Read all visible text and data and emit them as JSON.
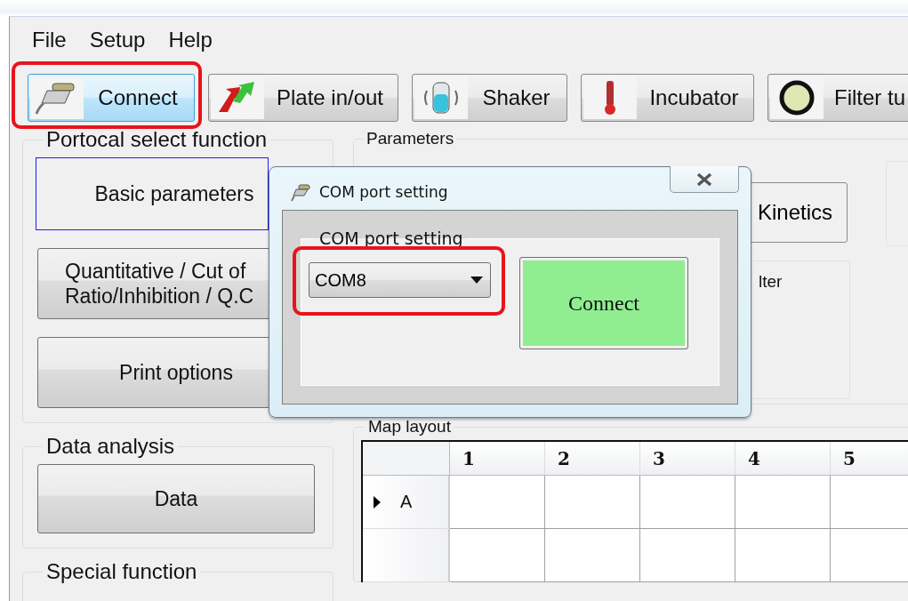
{
  "menu": [
    {
      "label": "File"
    },
    {
      "label": "Setup"
    },
    {
      "label": "Help"
    }
  ],
  "toolbar": [
    {
      "label": "Connect",
      "kind": "plug",
      "selected": true,
      "highlighted": true
    },
    {
      "label": "Plate in/out",
      "kind": "arrows",
      "selected": false,
      "highlighted": false
    },
    {
      "label": "Shaker",
      "kind": "tube",
      "selected": false,
      "highlighted": false
    },
    {
      "label": "Incubator",
      "kind": "thermometer",
      "selected": false,
      "highlighted": false
    },
    {
      "label": "Filter tu",
      "kind": "ring",
      "selected": false,
      "highlighted": false
    }
  ],
  "protocol_group": {
    "title": "Portocal select function",
    "buttons": [
      {
        "label": "Basic parameters",
        "selected": true
      },
      {
        "label": "Quantitative / Cut of\nRatio/Inhibition / Q.C",
        "selected": false
      },
      {
        "label": "Print options",
        "selected": false
      }
    ]
  },
  "data_group": {
    "title": "Data analysis",
    "buttons": [
      {
        "label": "Data",
        "selected": false
      }
    ]
  },
  "special_group": {
    "title": "Special function"
  },
  "parameters_group": {
    "title": "Parameters",
    "mode_button": "Kinetics",
    "filter_label": "lter"
  },
  "map_layout": {
    "title": "Map layout",
    "columns": [
      "1",
      "2",
      "3",
      "4",
      "5"
    ],
    "rows": [
      {
        "label": "A",
        "current": true
      },
      {
        "current": false
      }
    ]
  },
  "dialog": {
    "title": "COM port setting",
    "group_title": "COM port setting",
    "port": {
      "value": "COM8",
      "highlighted": true
    },
    "connect_button": "Connect"
  }
}
